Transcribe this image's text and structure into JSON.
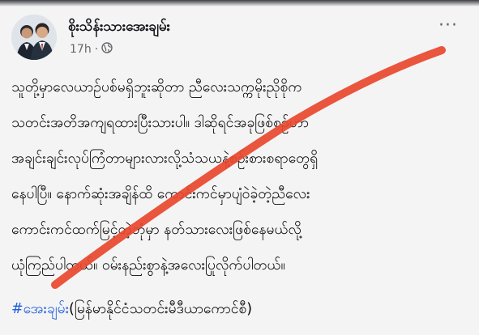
{
  "post": {
    "author_name": "စိုးသိန်းသားအေးချမ်း",
    "timestamp": "17h",
    "separator": "·",
    "privacy_icon": "globe-icon",
    "more_icon": "ellipsis-icon",
    "more_label": "···",
    "lines": [
      "သူတို့မှာလေယာဉ်ပစ်မရှိဘူးဆိုတာ ညီလေးသက္ကမိုးညိုစိုက",
      "သတင်းအတိအကျရထားပြီးသားပါ။ ဒါဆိုရင်အခုဖြစ်စဉ်ဟာ",
      "အချင်းချင်းလုပ်ကြံတာများလားလို့သံသယနဲ့စဉ်းစားစရာတွေရှိ",
      "နေပါပြီ။ နောက်ဆုံးအချိန်ထိ ကောင်းကင်မှာပျံဝဲခဲ့တဲ့ညီလေး",
      "ကောင်းကင်ထက်မြင့်တဲ့ဘုံမှာ နတ်သားလေးဖြစ်နေမယ်လို့",
      "ယုံကြည်ပါတယ်။ ဝမ်းနည်းစွာနဲ့အလေးပြုလိုက်ပါတယ်။"
    ],
    "hashtag": "#အေးချမ်း",
    "hashtag_suffix": "(မြန်မာနိုင်ငံသတင်းမီဒီယာကောင်စီ)"
  },
  "colors": {
    "background": "#f4f4f5",
    "text": "#050505",
    "meta": "#65676b",
    "hashtag": "#1f5fd6",
    "strike": "#e8462c"
  }
}
